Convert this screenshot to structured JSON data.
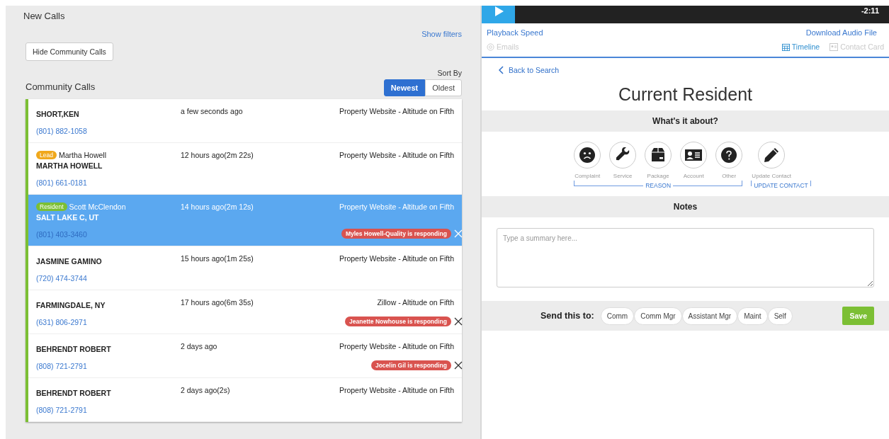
{
  "calls_panel": {
    "title": "New Calls",
    "show_filters": "Show filters",
    "hide_button": "Hide Community Calls",
    "section_title": "Community Calls",
    "sort": {
      "label": "Sort By",
      "options": [
        {
          "label": "Newest",
          "selected": true
        },
        {
          "label": "Oldest",
          "selected": false
        }
      ]
    },
    "calls": [
      {
        "name": "SHORT,KEN",
        "time": "a few seconds ago",
        "source": "Property Website - Altitude on Fifth",
        "phone": "(801) 882-1058",
        "selected": false
      },
      {
        "badge": {
          "label": "Lead",
          "kind": "lead"
        },
        "contact": "Martha Howell",
        "name": "MARTHA HOWELL",
        "time": "12 hours ago(2m 22s)",
        "source": "Property Website - Altitude on Fifth",
        "phone": "(801) 661-0181",
        "selected": false
      },
      {
        "badge": {
          "label": "Resident",
          "kind": "resident"
        },
        "contact": "Scott McClendon",
        "name": "SALT LAKE C, UT",
        "time": "14 hours ago(2m 12s)",
        "source": "Property Website - Altitude on Fifth",
        "phone": "(801) 403-3460",
        "responder": "Myles Howell-Quality is responding",
        "selected": true
      },
      {
        "name": "JASMINE GAMINO",
        "time": "15 hours ago(1m 25s)",
        "source": "Property Website - Altitude on Fifth",
        "phone": "(720) 474-3744",
        "selected": false
      },
      {
        "name": "FARMINGDALE, NY",
        "time": "17 hours ago(6m 35s)",
        "source": "Zillow - Altitude on Fifth",
        "phone": "(631) 806-2971",
        "responder": "Jeanette Nowhouse is responding",
        "selected": false
      },
      {
        "name": "BEHRENDT ROBERT",
        "time": "2 days ago",
        "source": "Property Website - Altitude on Fifth",
        "phone": "(808) 721-2791",
        "responder": "Jocelin Gil is responding",
        "selected": false
      },
      {
        "name": "BEHRENDT ROBERT",
        "time": "2 days ago(2s)",
        "source": "Property Website - Altitude on Fifth",
        "phone": "(808) 721-2791",
        "selected": false
      }
    ]
  },
  "detail_panel": {
    "player": {
      "time": "-2:11"
    },
    "playback_speed": "Playback Speed",
    "download": "Download Audio File",
    "tabs": [
      {
        "label": "Emails",
        "disabled": true
      },
      {
        "label": "Timeline",
        "disabled": false
      },
      {
        "label": "Contact Card",
        "disabled": true
      }
    ],
    "back": "Back to Search",
    "title": "Current Resident",
    "about_header": "What's it about?",
    "reasons": [
      {
        "label": "Complaint"
      },
      {
        "label": "Service"
      },
      {
        "label": "Package"
      },
      {
        "label": "Account"
      },
      {
        "label": "Other"
      }
    ],
    "reason_group": "REASON",
    "update_contact": {
      "label": "Update Contact"
    },
    "update_group": "UPDATE CONTACT",
    "notes_header": "Notes",
    "notes_placeholder": "Type a summary here...",
    "send_label": "Send this to:",
    "recipients": [
      "Comm",
      "Comm Mgr",
      "Assistant Mgr",
      "Maint",
      "Self"
    ],
    "save": "Save"
  }
}
